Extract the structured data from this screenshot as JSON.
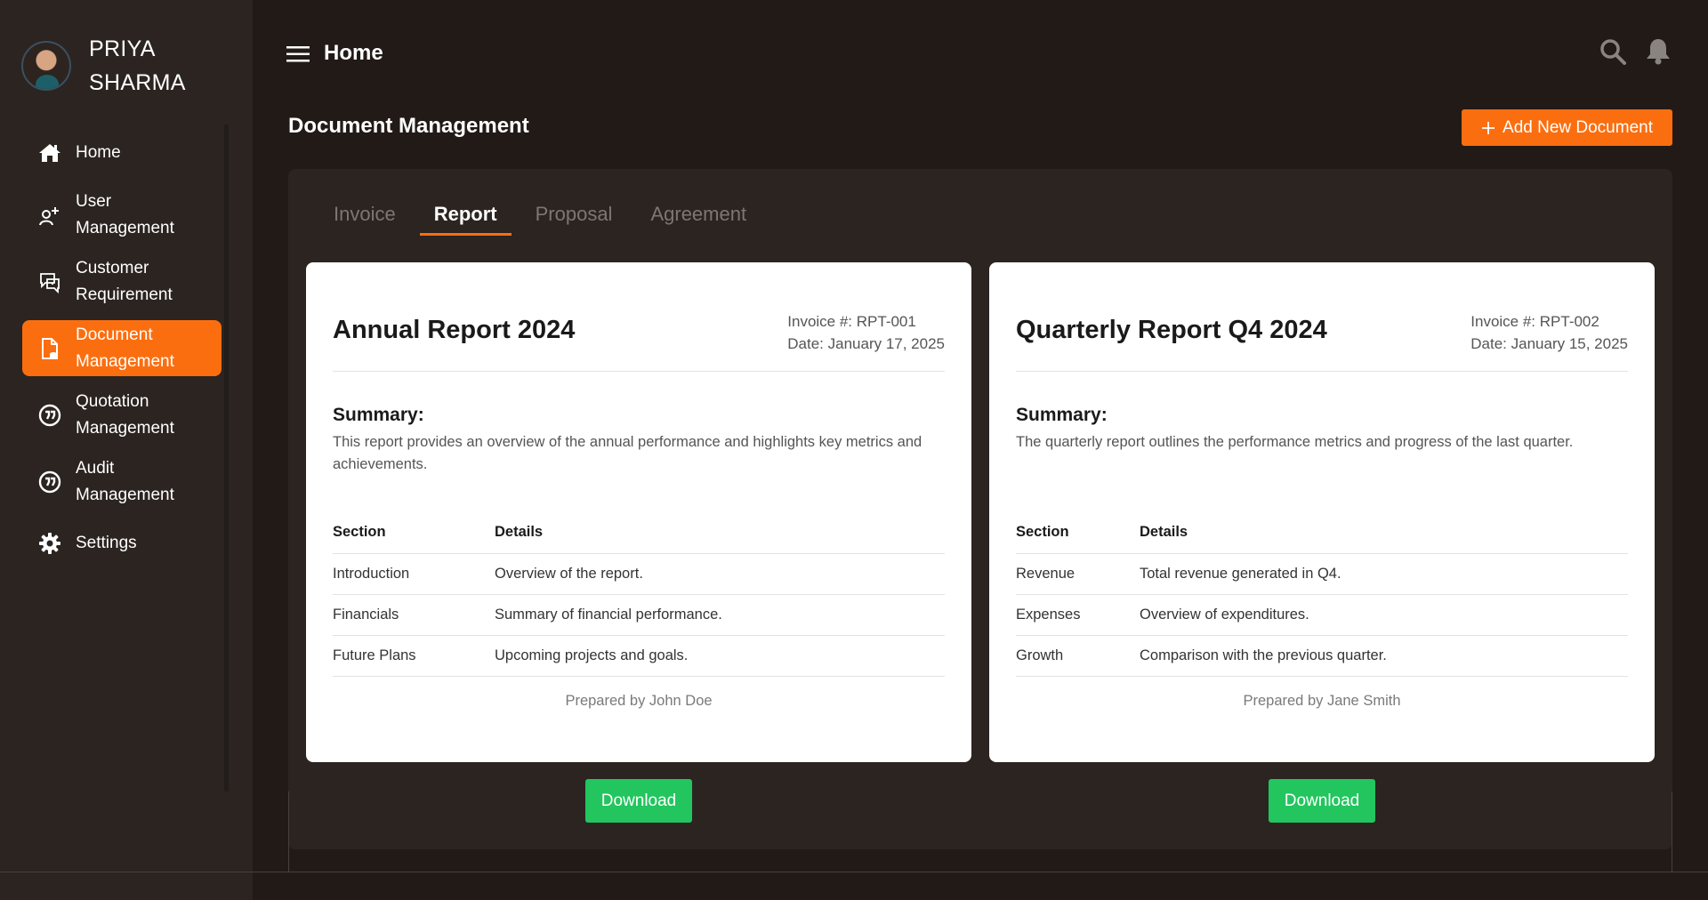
{
  "user": {
    "name": "PRIYA\nSHARMA"
  },
  "sidebar": {
    "items": [
      {
        "label": "Home",
        "icon": "home-icon"
      },
      {
        "label": "User\nManagement",
        "icon": "user-add-icon"
      },
      {
        "label": "Customer\nRequirement",
        "icon": "customer-chat-icon"
      },
      {
        "label": "Document\nManagement",
        "icon": "document-icon",
        "active": true
      },
      {
        "label": "Quotation\nManagement",
        "icon": "quotation-icon"
      },
      {
        "label": "Audit\nManagement",
        "icon": "audit-icon"
      },
      {
        "label": "Settings",
        "icon": "gear-icon"
      }
    ]
  },
  "header": {
    "crumb": "Home"
  },
  "page": {
    "title": "Document Management",
    "add_label": "Add New Document"
  },
  "tabs": [
    "Invoice",
    "Report",
    "Proposal",
    "Agreement"
  ],
  "active_tab": "Report",
  "cards": [
    {
      "title": "Annual Report 2024",
      "invoice": "Invoice #: RPT-001",
      "date": "Date: January 17, 2025",
      "summary_heading": "Summary:",
      "summary": "This report provides an overview of the annual performance and highlights key metrics and achievements.",
      "table_headers": [
        "Section",
        "Details"
      ],
      "rows": [
        [
          "Introduction",
          "Overview of the report."
        ],
        [
          "Financials",
          "Summary of financial performance."
        ],
        [
          "Future Plans",
          "Upcoming projects and goals."
        ]
      ],
      "prepared_by": "Prepared by John Doe",
      "download_label": "Download"
    },
    {
      "title": "Quarterly Report Q4 2024",
      "invoice": "Invoice #: RPT-002",
      "date": "Date: January 15, 2025",
      "summary_heading": "Summary:",
      "summary": "The quarterly report outlines the performance metrics and progress of the last quarter.",
      "table_headers": [
        "Section",
        "Details"
      ],
      "rows": [
        [
          "Revenue",
          "Total revenue generated in Q4."
        ],
        [
          "Expenses",
          "Overview of expenditures."
        ],
        [
          "Growth",
          "Comparison with the previous quarter."
        ]
      ],
      "prepared_by": "Prepared by Jane Smith",
      "download_label": "Download"
    }
  ],
  "colors": {
    "accent": "#fb6e0f",
    "success": "#22c55e",
    "background": "#221a16",
    "sidebar": "#2b2420"
  }
}
